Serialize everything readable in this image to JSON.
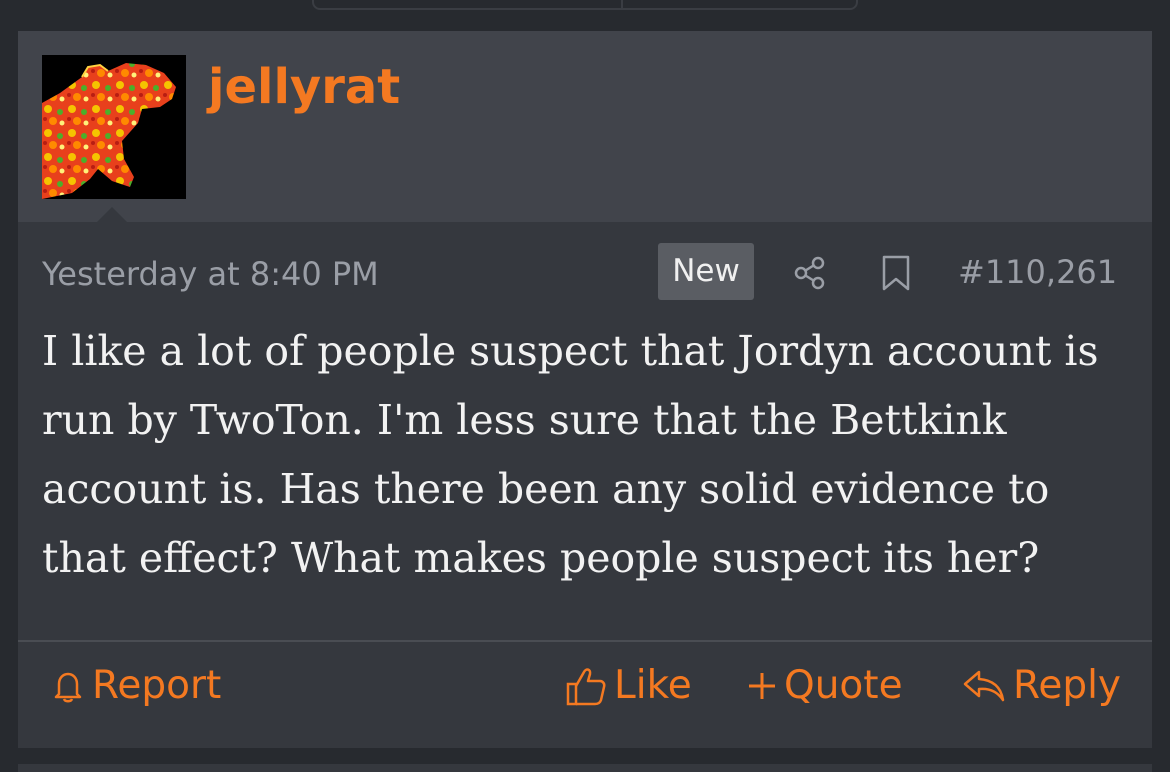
{
  "post": {
    "username": "jellyrat",
    "timestamp": "Yesterday at 8:40 PM",
    "badge": "New",
    "post_number": "#110,261",
    "body": "I like a lot of people suspect that Jordyn account is run by TwoTon. I'm less sure that the Bettkink account is. Has there been any solid evidence to that effect? What makes people suspect its her?"
  },
  "actions": {
    "report": "Report",
    "like": "Like",
    "quote": "Quote",
    "reply": "Reply"
  },
  "icons": {
    "share": "share-icon",
    "bookmark": "bookmark-icon",
    "report": "bell-icon",
    "like": "thumbs-up-icon",
    "quote": "plus-icon",
    "reply": "reply-icon"
  },
  "colors": {
    "accent": "#f47921",
    "page_background": "#272a2f",
    "header_background": "#41444b",
    "body_background": "#35383e",
    "muted_text": "#9a9ea6",
    "badge_background": "#5a5d63"
  }
}
